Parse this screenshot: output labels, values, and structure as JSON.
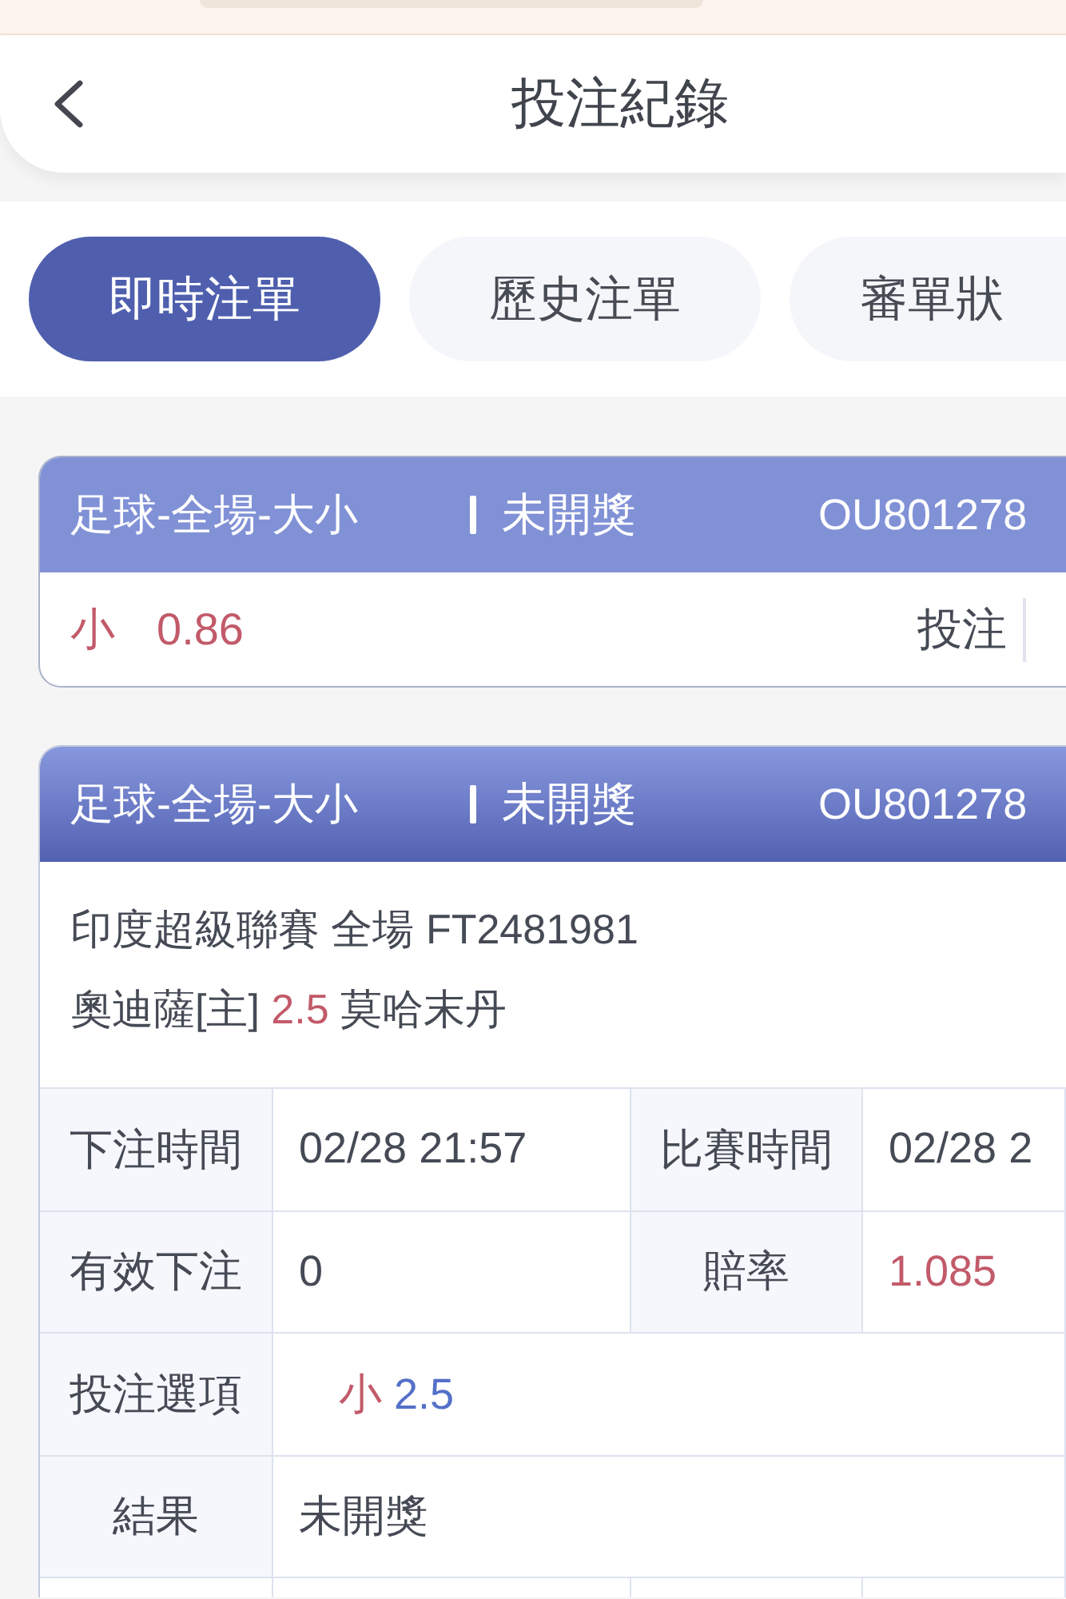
{
  "header": {
    "title": "投注紀錄"
  },
  "tabs": [
    {
      "label": "即時注單",
      "selected": true
    },
    {
      "label": "歷史注單",
      "selected": false
    },
    {
      "label": "審單狀",
      "selected": false
    }
  ],
  "bets": [
    {
      "kind": "summary",
      "market": "足球-全場-大小",
      "status": "未開獎",
      "order_id": "OU801278",
      "pick": "小",
      "odds": "0.86",
      "action": "投注"
    },
    {
      "kind": "detail",
      "market": "足球-全場-大小",
      "status": "未開獎",
      "order_id": "OU801278",
      "league": "印度超級聯賽 全場 FT2481981",
      "home": "奧迪薩[主]",
      "handicap": "2.5",
      "away": "莫哈末丹",
      "rows": [
        [
          {
            "label": "下注時間",
            "kind": "text",
            "value": "02/28 21:57"
          },
          {
            "label": "比賽時間",
            "kind": "text",
            "value": "02/28 2"
          }
        ],
        [
          {
            "label": "有效下注",
            "kind": "text",
            "value": "0"
          },
          {
            "label": "賠率",
            "kind": "odds",
            "value": "1.085"
          }
        ],
        [
          {
            "label": "投注選項",
            "kind": "selection",
            "pick": "小",
            "line": "2.5"
          }
        ],
        [
          {
            "label": "結果",
            "kind": "text",
            "value": "未開獎"
          }
        ]
      ]
    }
  ]
}
